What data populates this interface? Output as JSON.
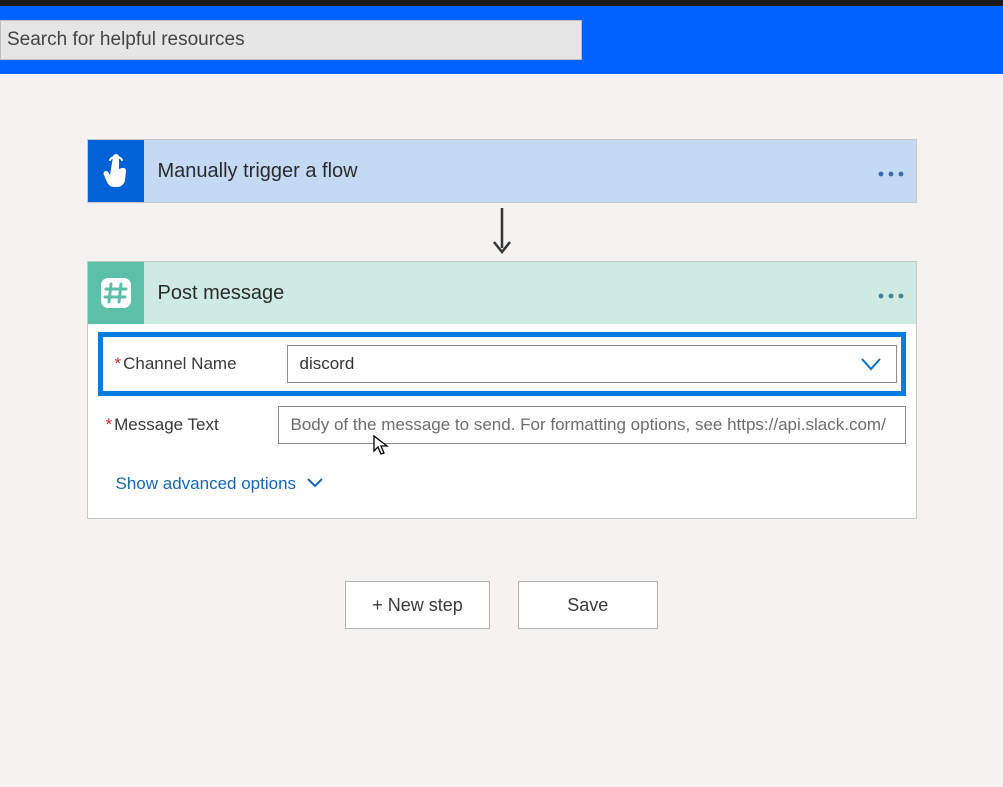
{
  "header": {
    "search_placeholder": "Search for helpful resources"
  },
  "trigger": {
    "title": "Manually trigger a flow"
  },
  "action": {
    "title": "Post message",
    "fields": {
      "channel_label": "Channel Name",
      "channel_value": "discord",
      "message_label": "Message Text",
      "message_placeholder": "Body of the message to send. For formatting options, see https://api.slack.com/"
    },
    "advanced_label": "Show advanced options"
  },
  "buttons": {
    "new_step": "+ New step",
    "save": "Save"
  }
}
